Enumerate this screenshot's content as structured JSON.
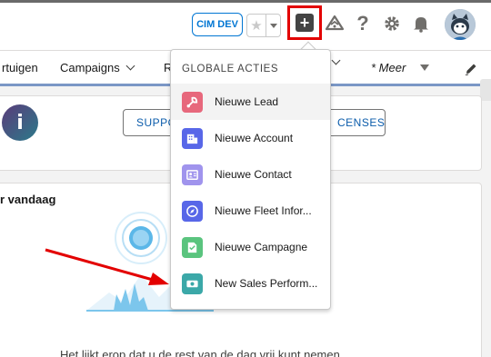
{
  "header": {
    "env_badge": "CIM DEV",
    "icons": [
      "favorites-star-icon",
      "favorites-dropdown-icon",
      "global-actions-plus-icon",
      "trailhead-icon",
      "help-icon",
      "setup-gear-icon",
      "notifications-bell-icon",
      "user-avatar"
    ]
  },
  "nav": {
    "items": [
      {
        "label": "rtuigen"
      },
      {
        "label": "Campaigns"
      },
      {
        "label": "R"
      },
      {
        "label": "* Meer"
      }
    ]
  },
  "card1": {
    "icon_letter": "i",
    "button_left": "SUPPO",
    "button_right": "CENSES"
  },
  "card2": {
    "title": "r vandaag",
    "bottom_text": "Het lijkt erop dat u de rest van de dag vrij kunt nemen"
  },
  "global_actions": {
    "header": "GLOBALE ACTIES",
    "items": [
      {
        "label": "Nieuwe Lead",
        "icon": "lead-icon",
        "color": "#e7687c"
      },
      {
        "label": "Nieuwe Account",
        "icon": "account-icon",
        "color": "#5867e8"
      },
      {
        "label": "Nieuwe Contact",
        "icon": "contact-icon",
        "color": "#a094ed"
      },
      {
        "label": "Nieuwe Fleet Infor...",
        "icon": "fleet-compass-icon",
        "color": "#5867e8"
      },
      {
        "label": "Nieuwe Campagne",
        "icon": "campaign-icon",
        "color": "#5ac47e"
      },
      {
        "label": "New Sales Perform...",
        "icon": "sales-performance-icon",
        "color": "#3ba8a8"
      }
    ]
  },
  "colors": {
    "highlight_box": "#e30000",
    "annotation_arrow": "#e30000",
    "brand_blue": "#0176d3"
  }
}
